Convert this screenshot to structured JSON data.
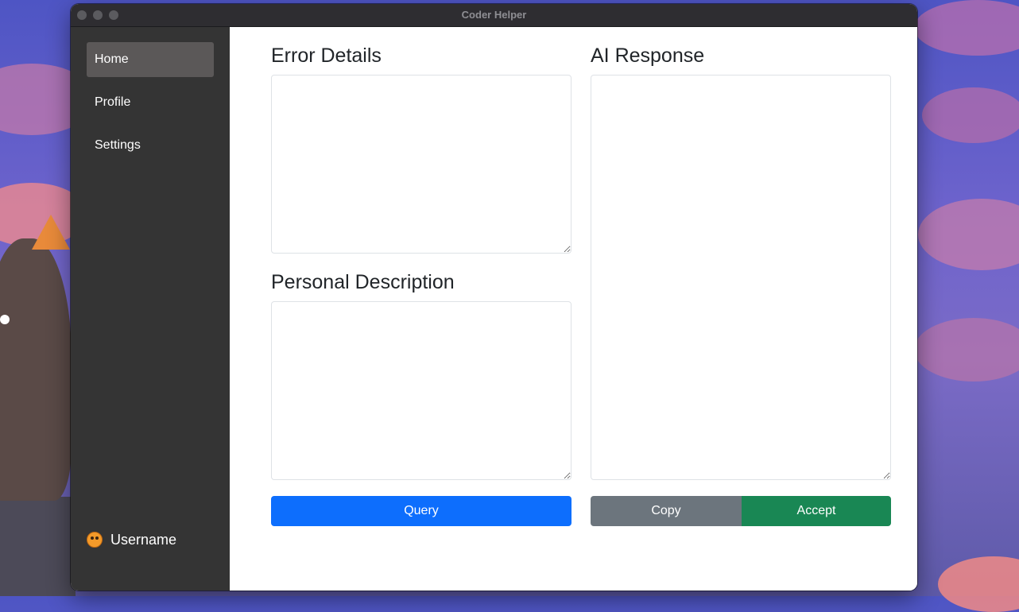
{
  "window": {
    "title": "Coder Helper"
  },
  "sidebar": {
    "items": [
      {
        "label": "Home",
        "active": true
      },
      {
        "label": "Profile",
        "active": false
      },
      {
        "label": "Settings",
        "active": false
      }
    ],
    "user": {
      "name": "Username",
      "avatar_icon": "avatar-icon"
    }
  },
  "main": {
    "error_details": {
      "heading": "Error Details",
      "value": ""
    },
    "personal_description": {
      "heading": "Personal Description",
      "value": ""
    },
    "ai_response": {
      "heading": "AI Response",
      "value": ""
    },
    "buttons": {
      "query": "Query",
      "copy": "Copy",
      "accept": "Accept"
    }
  },
  "colors": {
    "primary": "#0d6efd",
    "secondary": "#6c757d",
    "success": "#198754",
    "sidebar_bg": "#343434",
    "sidebar_active": "#5b5858"
  }
}
